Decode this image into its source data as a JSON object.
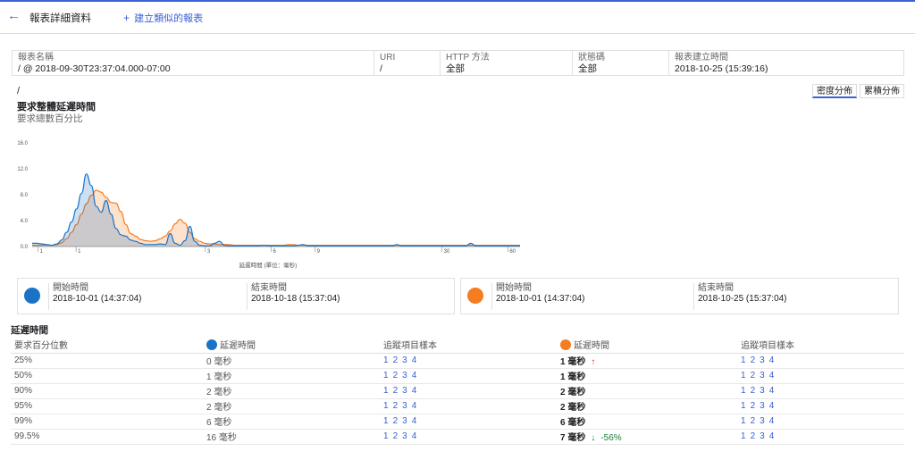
{
  "header": {
    "title": "報表詳細資料",
    "create_label": "建立類似的報表",
    "plus": "+",
    "back": "←"
  },
  "info": {
    "name": {
      "label": "報表名稱",
      "value": "/ @ 2018-09-30T23:37:04.000-07:00"
    },
    "uri": {
      "label": "URI",
      "value": "/"
    },
    "method": {
      "label": "HTTP 方法",
      "value": "全部"
    },
    "status": {
      "label": "狀態碼",
      "value": "全部"
    },
    "created": {
      "label": "報表建立時間",
      "value": "2018-10-25 (15:39:16)"
    }
  },
  "chart_header": {
    "path": "/",
    "title": "要求整體延遲時間",
    "subtitle": "要求總數百分比"
  },
  "toggles": {
    "density": "密度分佈",
    "cumulative": "累積分佈"
  },
  "chart_data": {
    "type": "area",
    "xlabel": "延遲時間 (單位：毫秒)",
    "ylabel": "",
    "ylim": [
      0,
      16
    ],
    "yticks": [
      "0.0",
      "4.0",
      "8.0",
      "12.0",
      "16.0"
    ],
    "xticks": [
      "1",
      "1",
      "3",
      "6",
      "9",
      "30",
      "60"
    ],
    "grid": false,
    "series": [
      {
        "color": "#1a73c7",
        "y": [
          0.5,
          0.5,
          0.4,
          0.3,
          0.2,
          0.4,
          1.0,
          2.2,
          3.8,
          5.8,
          8.2,
          11.2,
          9.4,
          6.2,
          5.3,
          7.1,
          5.0,
          2.8,
          1.8,
          1.6,
          1.0,
          0.8,
          0.5,
          0.3,
          0.3,
          0.3,
          0.4,
          0.3,
          2.0,
          0.5,
          0.2,
          0.9,
          3.1,
          0.8,
          0.2,
          0.1,
          0.1,
          0.5,
          0.8,
          0.2,
          0.1,
          0.1,
          0.1,
          0.1,
          0.1,
          0.1,
          0.1,
          0.2,
          0.1,
          0.1,
          0.1,
          0.1,
          0.1,
          0.1,
          0.2,
          0.3,
          0.1,
          0.1,
          0.1,
          0.1,
          0.1,
          0.1,
          0.1,
          0.1,
          0.1,
          0.1,
          0.1,
          0.1,
          0.1,
          0.1,
          0.1,
          0.1,
          0.1,
          0.1,
          0.3,
          0.1,
          0.1,
          0.1,
          0.1,
          0.1,
          0.1,
          0.1,
          0.1,
          0.1,
          0.1,
          0.1,
          0.1,
          0.1,
          0.1,
          0.5,
          0.1,
          0.1,
          0.1,
          0.1,
          0.1,
          0.1,
          0.1,
          0.1,
          0.1,
          0.1
        ]
      },
      {
        "color": "#f57c1f",
        "y": [
          0.2,
          0.2,
          0.2,
          0.2,
          0.2,
          0.3,
          0.6,
          1.2,
          2.2,
          3.4,
          5.0,
          6.6,
          7.9,
          8.7,
          8.4,
          7.6,
          6.8,
          6.7,
          5.4,
          3.4,
          2.0,
          1.6,
          1.1,
          0.9,
          0.8,
          0.9,
          1.2,
          1.6,
          2.4,
          3.5,
          4.2,
          3.6,
          2.2,
          1.2,
          0.8,
          0.5,
          0.4,
          0.4,
          0.3,
          0.3,
          0.3,
          0.2,
          0.2,
          0.2,
          0.2,
          0.2,
          0.2,
          0.2,
          0.2,
          0.2,
          0.2,
          0.2,
          0.3,
          0.3,
          0.2,
          0.2,
          0.2,
          0.2,
          0.2,
          0.2,
          0.2,
          0.2,
          0.2,
          0.2,
          0.2,
          0.2,
          0.2,
          0.2,
          0.2,
          0.2,
          0.2,
          0.2,
          0.2,
          0.2,
          0.2,
          0.2,
          0.2,
          0.2,
          0.2,
          0.2,
          0.2,
          0.2,
          0.2,
          0.2,
          0.2,
          0.2,
          0.2,
          0.2,
          0.2,
          0.2,
          0.2,
          0.2,
          0.2,
          0.2,
          0.2,
          0.2,
          0.2,
          0.2,
          0.2,
          0.2
        ]
      }
    ]
  },
  "legend": [
    {
      "color": "#1a73c7",
      "start_label": "開始時間",
      "start": "2018-10-01 (14:37:04)",
      "end_label": "結束時間",
      "end": "2018-10-18 (15:37:04)"
    },
    {
      "color": "#f57c1f",
      "start_label": "開始時間",
      "start": "2018-10-01 (14:37:04)",
      "end_label": "結束時間",
      "end": "2018-10-25 (15:37:04)"
    }
  ],
  "latency": {
    "title": "延遲時間",
    "headers": {
      "percentile": "要求百分位數",
      "latency": "延遲時間",
      "samples": "追蹤項目樣本"
    },
    "sample_links": [
      "1",
      "2",
      "3",
      "4"
    ],
    "rows": [
      {
        "pct": "25%",
        "a": "0 毫秒",
        "b": "1 毫秒",
        "arrow": "↑",
        "change": ""
      },
      {
        "pct": "50%",
        "a": "1 毫秒",
        "b": "1 毫秒",
        "arrow": "",
        "change": ""
      },
      {
        "pct": "90%",
        "a": "2 毫秒",
        "b": "2 毫秒",
        "arrow": "",
        "change": ""
      },
      {
        "pct": "95%",
        "a": "2 毫秒",
        "b": "2 毫秒",
        "arrow": "",
        "change": ""
      },
      {
        "pct": "99%",
        "a": "6 毫秒",
        "b": "6 毫秒",
        "arrow": "",
        "change": ""
      },
      {
        "pct": "99.5%",
        "a": "16 毫秒",
        "b": "7 毫秒",
        "arrow": "↓",
        "change": "-56%"
      }
    ]
  }
}
